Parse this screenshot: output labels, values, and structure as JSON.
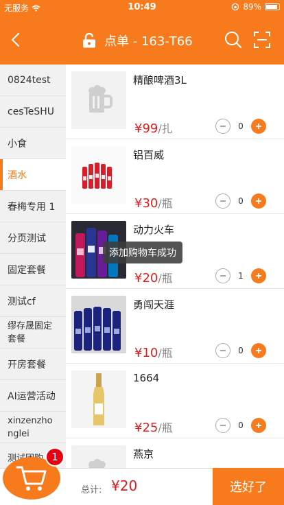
{
  "status_bar": {
    "carrier": "无服务",
    "time": "10:49",
    "battery": "89%"
  },
  "nav": {
    "title": "点单 - 163-T66"
  },
  "categories": [
    {
      "label": "0824test"
    },
    {
      "label": "cesTeSHU"
    },
    {
      "label": "小食"
    },
    {
      "label": "酒水",
      "active": true
    },
    {
      "label": "春梅专用 1"
    },
    {
      "label": "分页测试"
    },
    {
      "label": "固定套餐"
    },
    {
      "label": "测试cf"
    },
    {
      "label": "缪存晟固定套餐"
    },
    {
      "label": "开房套餐"
    },
    {
      "label": "AI运营活动"
    },
    {
      "label": "xinzenzhonglei"
    },
    {
      "label": "测试团购"
    }
  ],
  "products": [
    {
      "name": "精酿啤酒3L",
      "price": "¥99",
      "unit": "/扎",
      "qty": "0",
      "image": "beer-mug-placeholder"
    },
    {
      "name": "铝百威",
      "price": "¥30",
      "unit": "/瓶",
      "qty": "0",
      "image": "red-bottles"
    },
    {
      "name": "动力火车",
      "price": "¥20",
      "unit": "/瓶",
      "qty": "1",
      "image": "colorful-bottles"
    },
    {
      "name": "勇闯天涯",
      "price": "¥10",
      "unit": "/瓶",
      "qty": "0",
      "image": "blue-bottles"
    },
    {
      "name": "1664",
      "price": "¥25",
      "unit": "/瓶",
      "qty": "0",
      "image": "wine-bottle"
    },
    {
      "name": "燕京",
      "price": "",
      "unit": "",
      "qty": "",
      "image": "beer-mug-placeholder"
    }
  ],
  "toast": "添加购物车成功",
  "footer": {
    "cart_count": "1",
    "total_label": "总计:",
    "total_value": "¥20",
    "confirm_label": "选好了"
  },
  "colors": {
    "accent": "#f77b1c",
    "price": "#e41c1c",
    "badge": "#e60012"
  }
}
